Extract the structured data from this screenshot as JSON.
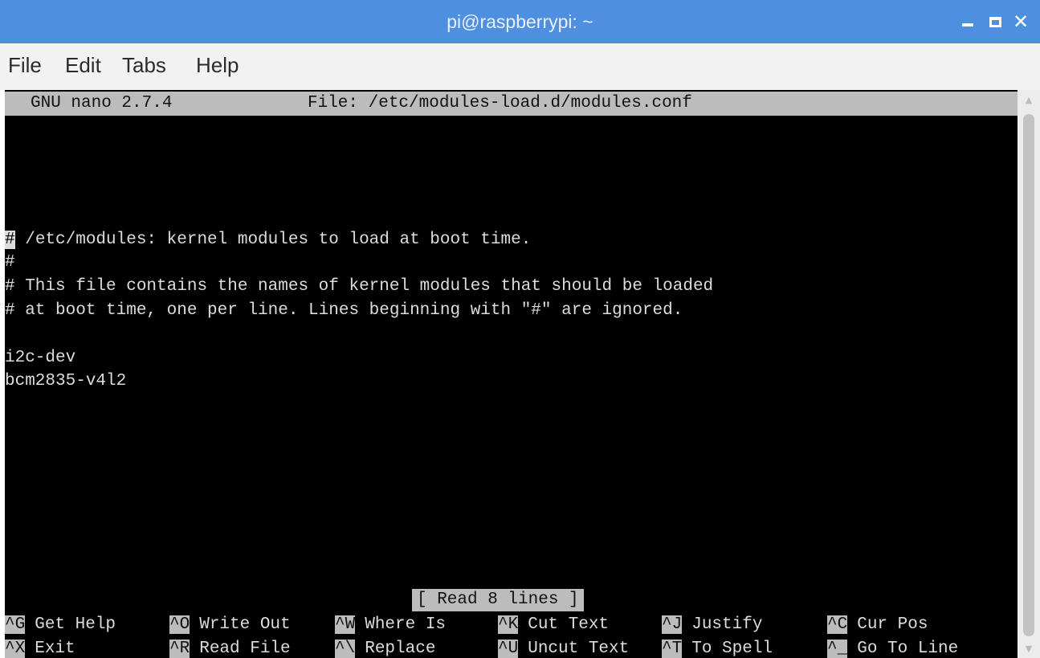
{
  "window": {
    "title": "pi@raspberrypi: ~",
    "controls": {
      "minimize_icon": "minimize-icon",
      "maximize_icon": "maximize-icon",
      "close_label": "✕"
    }
  },
  "menu": [
    "File",
    "Edit",
    "Tabs",
    "Help"
  ],
  "nano": {
    "version": "GNU nano 2.7.4",
    "file": "File: /etc/modules-load.d/modules.conf",
    "content": {
      "cursor_char": "#",
      "line1_rest": " /etc/modules: kernel modules to load at boot time.",
      "line2": "#",
      "line3": "# This file contains the names of kernel modules that should be loaded",
      "line4": "# at boot time, one per line. Lines beginning with \"#\" are ignored.",
      "line5": "",
      "line6": "i2c-dev",
      "line7": "bcm2835-v4l2"
    },
    "status_message": "[ Read 8 lines ]",
    "shortcuts": [
      [
        {
          "key": "^G",
          "label": "Get Help"
        },
        {
          "key": "^O",
          "label": "Write Out"
        },
        {
          "key": "^W",
          "label": "Where Is"
        },
        {
          "key": "^K",
          "label": "Cut Text"
        },
        {
          "key": "^J",
          "label": "Justify"
        },
        {
          "key": "^C",
          "label": "Cur Pos"
        }
      ],
      [
        {
          "key": "^X",
          "label": "Exit"
        },
        {
          "key": "^R",
          "label": "Read File"
        },
        {
          "key": "^\\",
          "label": "Replace"
        },
        {
          "key": "^U",
          "label": "Uncut Text"
        },
        {
          "key": "^T",
          "label": "To Spell"
        },
        {
          "key": "^_",
          "label": "Go To Line"
        }
      ]
    ]
  },
  "colors": {
    "titlebar": "#4f8fe0",
    "menubar": "#f2f2f2",
    "terminal_bg": "#000000",
    "terminal_fg": "#dcdcdc",
    "highlight": "#bcbcbc"
  }
}
